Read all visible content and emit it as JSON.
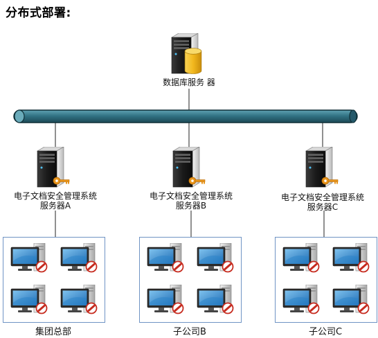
{
  "title": "分布式部署:",
  "db_server": {
    "label": "数据库服务 器"
  },
  "servers": [
    {
      "line1": "电子文档安全管理系统",
      "line2": "服务器A"
    },
    {
      "line1": "电子文档安全管理系统",
      "line2": "服务器B"
    },
    {
      "line1": "电子文档安全管理系统",
      "line2": "服务器C"
    }
  ],
  "offices": [
    {
      "label": "集团总部"
    },
    {
      "label": "子公司B"
    },
    {
      "label": "子公司C"
    }
  ],
  "colors": {
    "bus": "#2f6f80",
    "box_border": "#6f93c4",
    "lock": "#c62b1f",
    "key": "#e8951c",
    "db": "#f2b81e"
  }
}
